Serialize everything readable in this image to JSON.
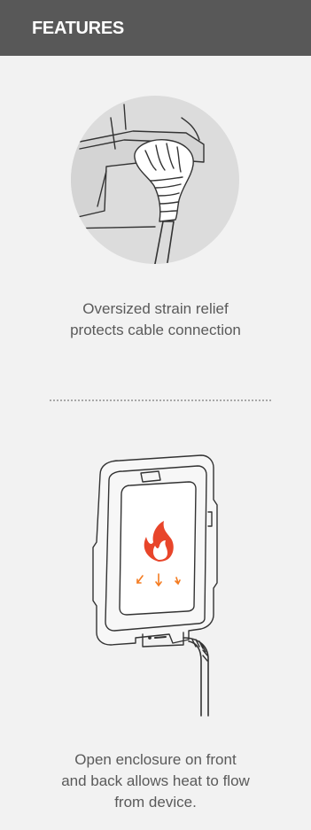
{
  "header": {
    "title": "FEATURES"
  },
  "features": [
    {
      "icon": "strain-relief-illustration",
      "caption_lines": [
        "Oversized strain relief",
        "protects cable connection"
      ]
    },
    {
      "icon": "open-enclosure-illustration",
      "caption_lines": [
        "Open enclosure on front",
        "and back allows heat to flow",
        "from device."
      ]
    }
  ],
  "colors": {
    "header_bg": "#585858",
    "panel_bg": "#f2f2f2",
    "caption_text": "#5a5a5a",
    "flame_red": "#e8452a",
    "flame_orange": "#f47b20"
  }
}
